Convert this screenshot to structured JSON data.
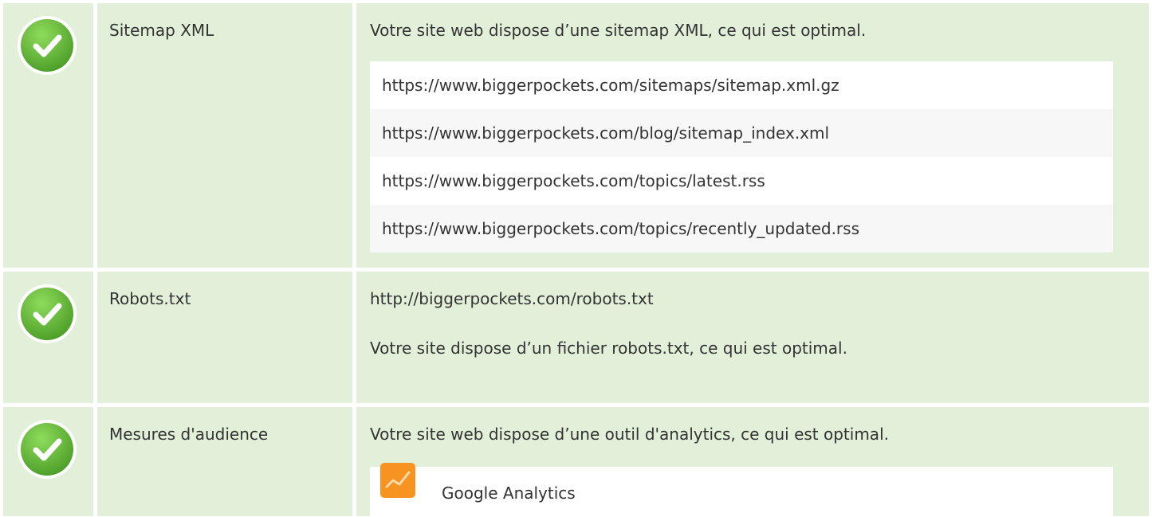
{
  "colors": {
    "row_background": "#e2f0d9",
    "check_green": "#5cb531",
    "analytics_orange": "#f79421"
  },
  "rows": [
    {
      "icon": "check-circle-icon",
      "label": "Sitemap XML",
      "message": "Votre site web dispose d’une sitemap XML, ce qui est optimal.",
      "urls": [
        "https://www.biggerpockets.com/sitemaps/sitemap.xml.gz",
        "https://www.biggerpockets.com/blog/sitemap_index.xml",
        "https://www.biggerpockets.com/topics/latest.rss",
        "https://www.biggerpockets.com/topics/recently_updated.rss"
      ]
    },
    {
      "icon": "check-circle-icon",
      "label": "Robots.txt",
      "url": "http://biggerpockets.com/robots.txt",
      "message": "Votre site dispose d’un fichier robots.txt, ce qui est optimal."
    },
    {
      "icon": "check-circle-icon",
      "label": "Mesures d'audience",
      "message": "Votre site web dispose d’une outil d'analytics, ce qui est optimal.",
      "tool": {
        "icon": "google-analytics-icon",
        "name": "Google Analytics"
      }
    }
  ]
}
